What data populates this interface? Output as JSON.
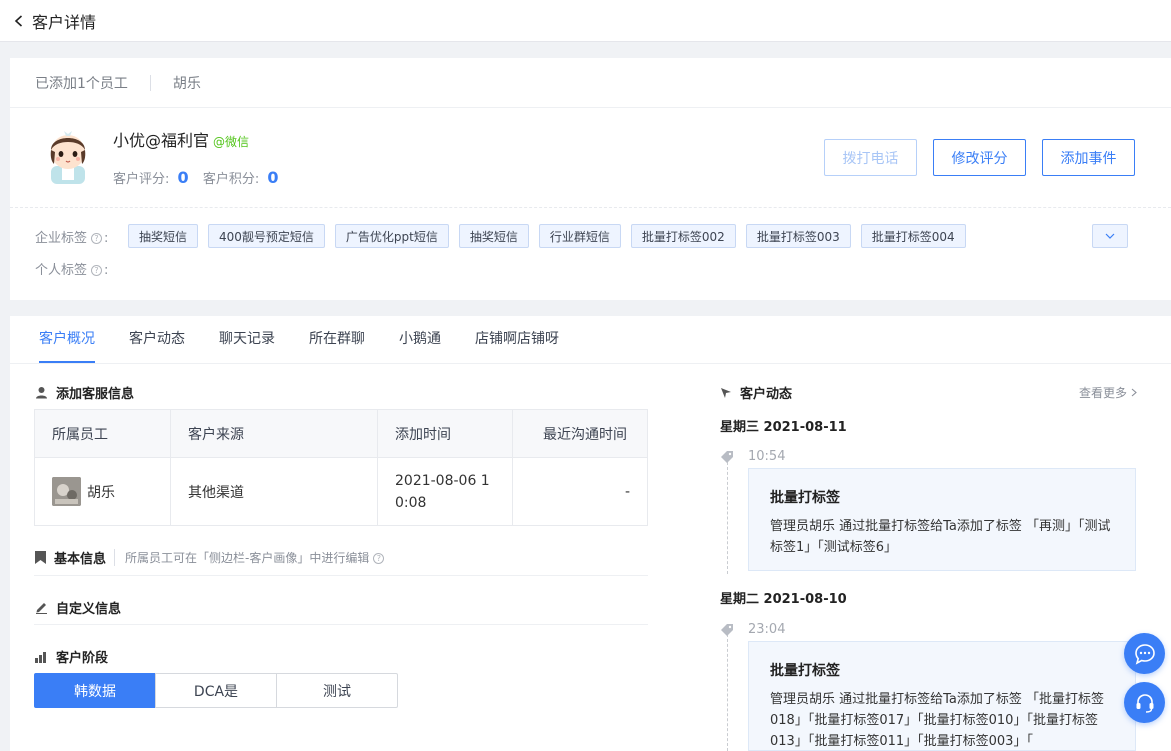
{
  "header": {
    "title": "客户详情"
  },
  "staff_bar": {
    "added": "已添加1个员工",
    "staff": "胡乐"
  },
  "customer": {
    "name": "小优@福利官",
    "source_tag": "@微信",
    "rating_label": "客户评分:",
    "rating_value": "0",
    "points_label": "客户积分:",
    "points_value": "0"
  },
  "actions": {
    "call": "拨打电话",
    "edit_rating": "修改评分",
    "add_event": "添加事件"
  },
  "tags": {
    "enterprise_label": "企业标签",
    "personal_label": "个人标签",
    "enterprise": [
      "抽奖短信",
      "400靓号预定短信",
      "广告优化ppt短信",
      "抽奖短信",
      "行业群短信",
      "批量打标签002",
      "批量打标签003",
      "批量打标签004"
    ]
  },
  "tabs": [
    "客户概况",
    "客户动态",
    "聊天记录",
    "所在群聊",
    "小鹅通",
    "店铺啊店铺呀"
  ],
  "service_info": {
    "title": "添加客服信息",
    "columns": [
      "所属员工",
      "客户来源",
      "添加时间",
      "最近沟通时间"
    ],
    "row": {
      "staff": "胡乐",
      "source": "其他渠道",
      "added_time_line1": "2021-08-06 1",
      "added_time_line2": "0:08",
      "last_contact": "-"
    }
  },
  "basic_info": {
    "title": "基本信息",
    "hint": "所属员工可在「侧边栏-客户画像」中进行编辑"
  },
  "custom_info": {
    "title": "自定义信息"
  },
  "stage": {
    "title": "客户阶段",
    "options": [
      "韩数据",
      "DCA是",
      "测试"
    ]
  },
  "activity": {
    "title": "客户动态",
    "see_more": "查看更多",
    "groups": [
      {
        "date": "星期三 2021-08-11",
        "time": "10:54",
        "event_title": "批量打标签",
        "event_text": "管理员胡乐  通过批量打标签给Ta添加了标签 「再测」「测试标签1」「测试标签6」"
      },
      {
        "date": "星期二 2021-08-10",
        "time": "23:04",
        "event_title": "批量打标签",
        "event_text": "管理员胡乐  通过批量打标签给Ta添加了标签 「批量打标签018」「批量打标签017」「批量打标签010」「批量打标签013」「批量打标签011」「批量打标签003」「"
      }
    ]
  }
}
